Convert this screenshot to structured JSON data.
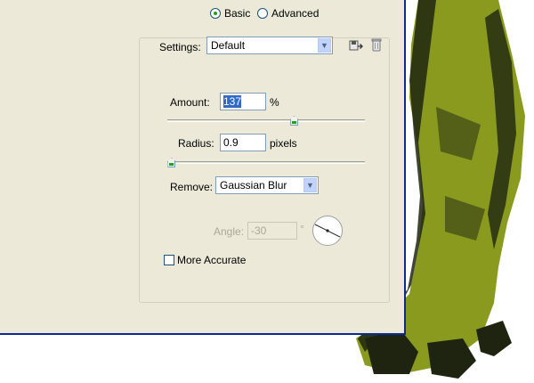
{
  "mode": {
    "basic_label": "Basic",
    "advanced_label": "Advanced",
    "selected": "Basic"
  },
  "settings": {
    "label": "Settings:",
    "value": "Default",
    "save_icon": "save-settings-icon",
    "delete_icon": "trash-icon"
  },
  "amount": {
    "label": "Amount:",
    "value": "137",
    "unit": "%",
    "slider_fraction": 0.64
  },
  "radius": {
    "label": "Radius:",
    "value": "0.9",
    "unit": "pixels",
    "slider_fraction": 0.02
  },
  "remove": {
    "label": "Remove:",
    "value": "Gaussian Blur"
  },
  "angle": {
    "label": "Angle:",
    "value": "-30",
    "unit": "°"
  },
  "more_accurate": {
    "label": "More Accurate",
    "checked": false
  },
  "colors": {
    "dialog_bg": "#ece9d8",
    "window_border": "#0a2b8f",
    "accent_green": "#21a121",
    "selection_blue": "#316ac5",
    "lizard_olive": "#8a9a1e"
  }
}
